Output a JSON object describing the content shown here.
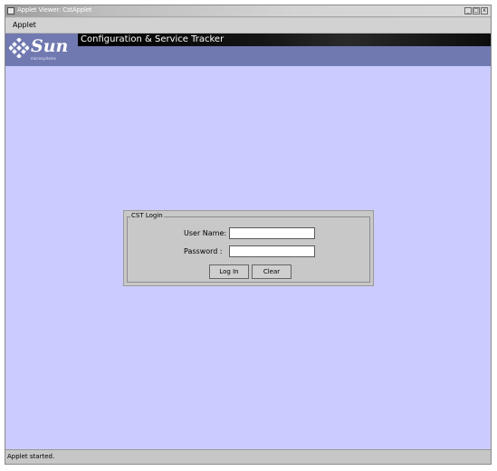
{
  "window": {
    "title": "Applet Viewer: CstApplet",
    "controls": [
      "_",
      "□",
      "x"
    ]
  },
  "menubar": {
    "items": [
      "Applet"
    ]
  },
  "header": {
    "logo_text": "Sun",
    "logo_subtext": "microsystems",
    "app_title": "Configuration & Service Tracker"
  },
  "login": {
    "legend": "CST Login",
    "username_label": "User Name:",
    "username_value": "",
    "password_label": "Password  :",
    "password_value": "",
    "login_button": "Log In",
    "clear_button": "Clear"
  },
  "status": {
    "text": "Applet started."
  },
  "colors": {
    "content_bg": "#cbcbff",
    "header_bg": "#7079b0",
    "title_strip": "#000000",
    "panel_bg": "#c8c8c8"
  }
}
